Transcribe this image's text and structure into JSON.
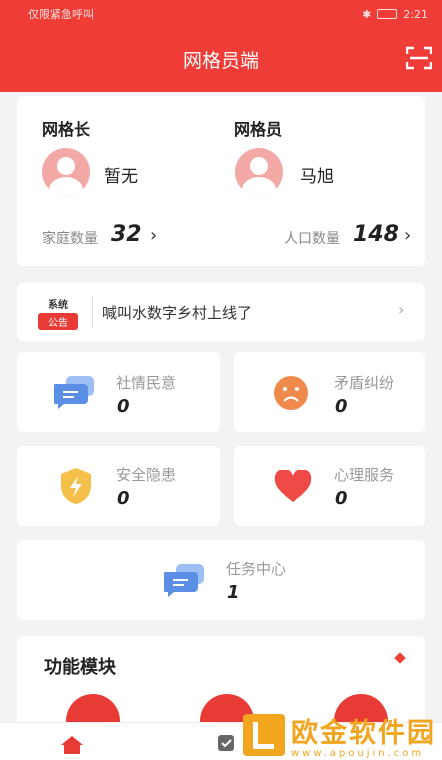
{
  "status_bar": {
    "left_text": "仅限紧急呼叫",
    "time": "2:21"
  },
  "header": {
    "title": "网格员端"
  },
  "grid_leader": {
    "title": "网格长",
    "name": "暂无"
  },
  "grid_member": {
    "title": "网格员",
    "name": "马旭"
  },
  "stats": {
    "households_label": "家庭数量",
    "households_value": "32",
    "population_label": "人口数量",
    "population_value": "148"
  },
  "notice": {
    "badge_top": "系统",
    "badge_bottom": "公告",
    "text": "喊叫水数字乡村上线了"
  },
  "tiles": [
    {
      "label": "社情民意",
      "value": "0",
      "icon": "chat-bubbles-icon",
      "color": "#5b8fe6"
    },
    {
      "label": "矛盾纠纷",
      "value": "0",
      "icon": "sad-face-icon",
      "color": "#f08a4b"
    },
    {
      "label": "安全隐患",
      "value": "0",
      "icon": "shield-bolt-icon",
      "color": "#f5c04a"
    },
    {
      "label": "心理服务",
      "value": "0",
      "icon": "heart-icon",
      "color": "#ef4a45"
    }
  ],
  "task_center": {
    "label": "任务中心",
    "value": "1",
    "icon": "chat-bubbles-icon"
  },
  "modules": {
    "title": "功能模块"
  },
  "watermark": {
    "cn": "欧金软件园",
    "en": "www.apoujin.com"
  },
  "colors": {
    "primary": "#ef3c36",
    "background": "#f3f3f5"
  }
}
